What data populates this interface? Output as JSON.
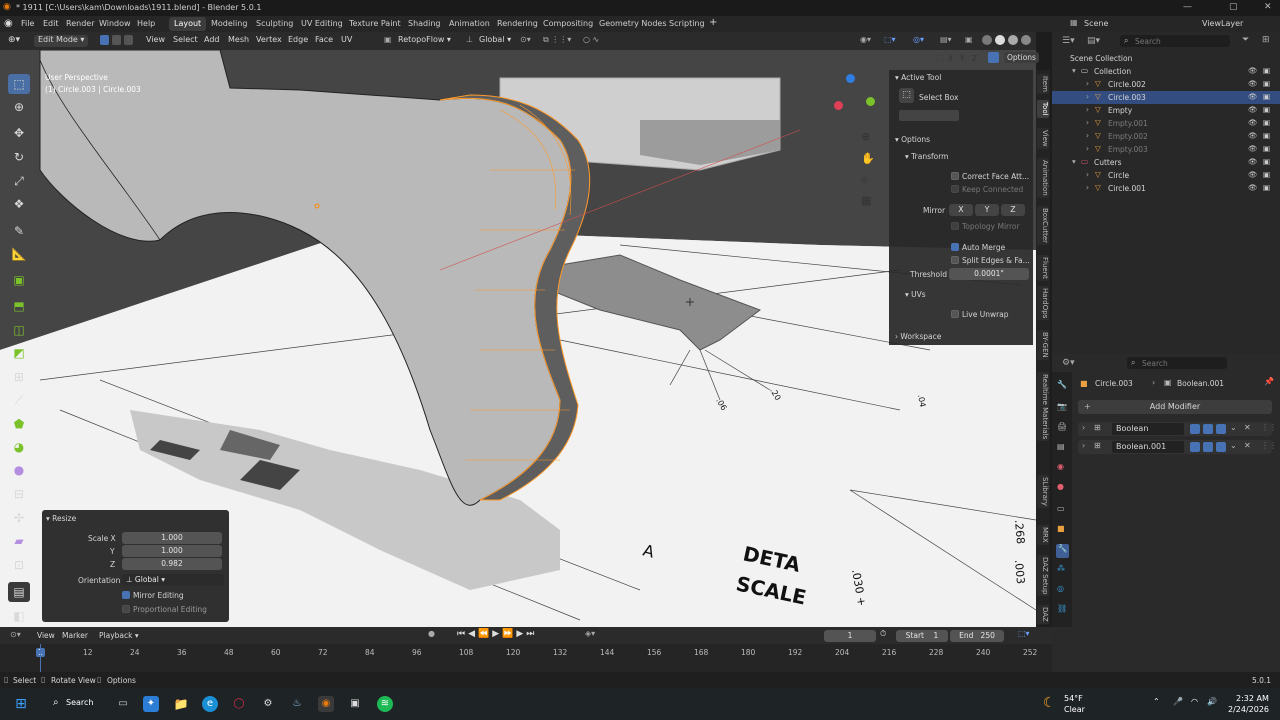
{
  "window": {
    "title": "* 1911 [C:\\Users\\kam\\Downloads\\1911.blend] - Blender 5.0.1"
  },
  "menu": [
    "File",
    "Edit",
    "Render",
    "Window",
    "Help"
  ],
  "workspaces": [
    "Layout",
    "Modeling",
    "Sculpting",
    "UV Editing",
    "Texture Paint",
    "Shading",
    "Animation",
    "Rendering",
    "Compositing",
    "Geometry Nodes",
    "Scripting"
  ],
  "active_workspace": "Layout",
  "scene": {
    "label": "Scene",
    "view_layer": "ViewLayer"
  },
  "viewport_header": {
    "mode": "Edit Mode",
    "menus": [
      "View",
      "Select",
      "Add",
      "Mesh",
      "Vertex",
      "Edge",
      "Face",
      "UV"
    ],
    "retopo": "RetopoFlow",
    "orientation": "Global",
    "options": "Options",
    "axes": [
      "X",
      "Y",
      "Z"
    ]
  },
  "viewport_info": {
    "perspective": "User Perspective",
    "object": "(1) Circle.003 | Circle.003"
  },
  "drawing_text": {
    "a_label": "A",
    "detail": "DETA",
    "scale": "SCALE",
    "d1": ".268",
    "d2": ".003",
    "d3": ".030 +",
    "d4": ".20",
    "d5": ".06",
    "d6": ".04"
  },
  "npanel": {
    "active_tool": "Active Tool",
    "tool_name": "Select Box",
    "options": "Options",
    "transform": "Transform",
    "correct_face": "Correct Face Att...",
    "keep_connected": "Keep Connected",
    "mirror": "Mirror",
    "mx": "X",
    "my": "Y",
    "mz": "Z",
    "topology_mirror": "Topology Mirror",
    "auto_merge": "Auto Merge",
    "split_edges": "Split Edges & Fa...",
    "threshold_label": "Threshold",
    "threshold": "0.0001\"",
    "uvs": "UVs",
    "live_unwrap": "Live Unwrap",
    "workspace": "Workspace"
  },
  "side_tabs": [
    "Item",
    "Tool",
    "View",
    "Animation",
    "BoxCutter",
    "Fluent",
    "HardOps",
    "BY-GEN",
    "Realtime Materials",
    "SLibrary",
    "MRX",
    "DAZ Setup",
    "DAZ"
  ],
  "resize_panel": {
    "title": "Resize",
    "scale_x_label": "Scale X",
    "scale_x": "1.000",
    "y_label": "Y",
    "y": "1.000",
    "z_label": "Z",
    "z": "0.982",
    "orientation_label": "Orientation",
    "orientation": "Global",
    "mirror_editing": "Mirror Editing",
    "proportional_editing": "Proportional Editing"
  },
  "outliner": {
    "search_placeholder": "Search",
    "scene_collection": "Scene Collection",
    "rows": [
      {
        "label": "Collection",
        "indent": 1,
        "selected": false,
        "dim": false
      },
      {
        "label": "Circle.002",
        "indent": 2,
        "selected": false,
        "dim": false
      },
      {
        "label": "Circle.003",
        "indent": 2,
        "selected": true,
        "dim": false
      },
      {
        "label": "Empty",
        "indent": 2,
        "selected": false,
        "dim": false
      },
      {
        "label": "Empty.001",
        "indent": 2,
        "selected": false,
        "dim": true
      },
      {
        "label": "Empty.002",
        "indent": 2,
        "selected": false,
        "dim": true
      },
      {
        "label": "Empty.003",
        "indent": 2,
        "selected": false,
        "dim": true
      },
      {
        "label": "Cutters",
        "indent": 1,
        "selected": false,
        "dim": false
      },
      {
        "label": "Circle",
        "indent": 2,
        "selected": false,
        "dim": false
      },
      {
        "label": "Circle.001",
        "indent": 2,
        "selected": false,
        "dim": false
      }
    ]
  },
  "properties": {
    "search_placeholder": "Search",
    "object": "Circle.003",
    "modifier_context": "Boolean.001",
    "add_modifier": "Add Modifier",
    "modifiers": [
      "Boolean",
      "Boolean.001"
    ]
  },
  "timeline": {
    "menus": [
      "View",
      "Marker",
      "Playback"
    ],
    "current_frame": "1",
    "start_label": "Start",
    "start": "1",
    "end_label": "End",
    "end": "250",
    "ticks": [
      "1",
      "12",
      "24",
      "36",
      "48",
      "60",
      "72",
      "84",
      "96",
      "108",
      "120",
      "132",
      "144",
      "156",
      "168",
      "180",
      "192",
      "204",
      "216",
      "228",
      "240",
      "252"
    ]
  },
  "statusbar": {
    "select": "Select",
    "rotate": "Rotate View",
    "options": "Options",
    "version": "5.0.1"
  },
  "taskbar": {
    "search": "Search",
    "weather_temp": "54°F",
    "weather_desc": "Clear",
    "time": "2:32 AM",
    "date": "2/24/2026"
  }
}
